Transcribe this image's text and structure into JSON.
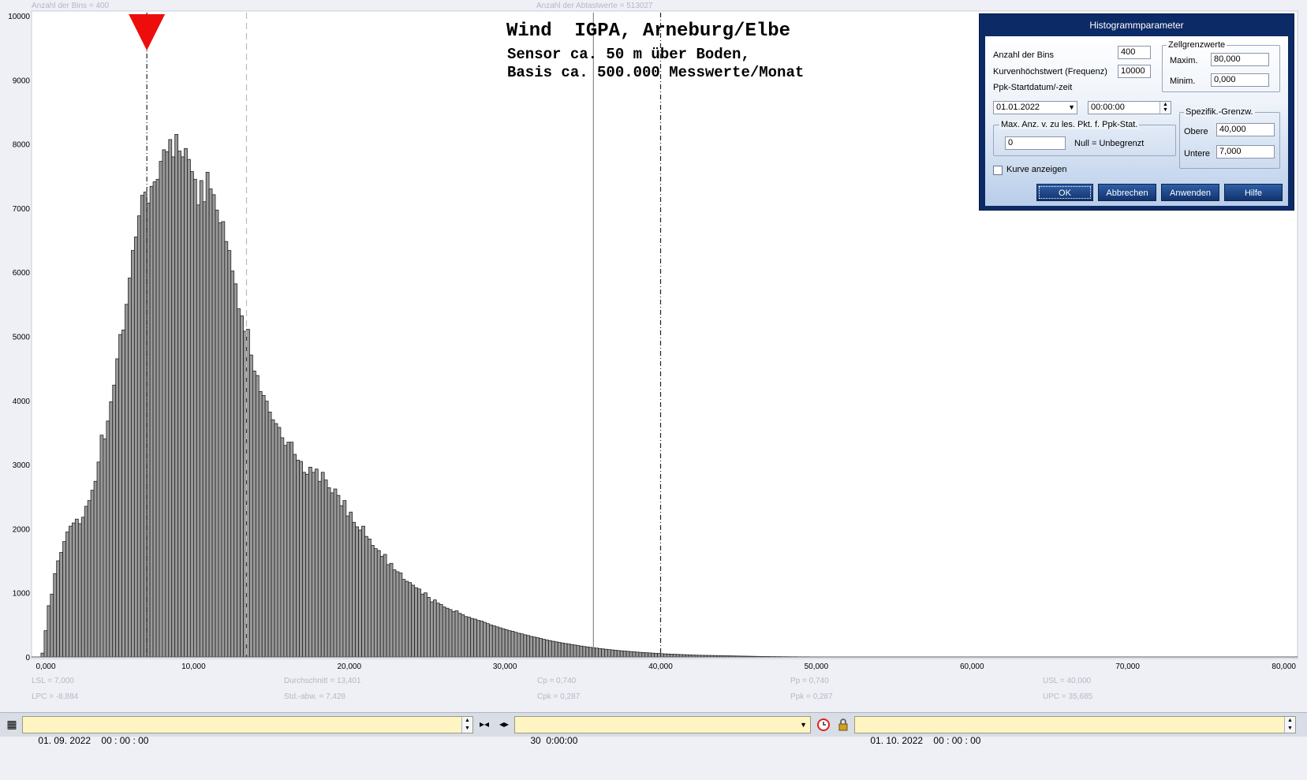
{
  "top_info": {
    "bins_text": "Anzahl der Bins =   400",
    "samples_text": "Anzahl der Abtastwerte = 513027"
  },
  "chart_title": {
    "line1": "Wind  IGPA, Arneburg/Elbe",
    "line2": "Sensor ca. 50 m über Boden,",
    "line3": "Basis ca. 500.000 Messwerte/Monat"
  },
  "chart_data": {
    "type": "bar",
    "xlim": [
      0,
      80
    ],
    "ylim": [
      0,
      10000
    ],
    "x_tick_labels": [
      "0,000",
      "10,000",
      "20,000",
      "30,000",
      "40,000",
      "50,000",
      "60,000",
      "70,000",
      "80,000"
    ],
    "y_tick_labels": [
      "0",
      "1000",
      "2000",
      "3000",
      "4000",
      "5000",
      "6000",
      "7000",
      "8000",
      "9000",
      "10000"
    ],
    "bin_width": 0.2,
    "bin_start": 0.2,
    "values": [
      60,
      410,
      800,
      980,
      1300,
      1500,
      1630,
      1800,
      1950,
      2040,
      2090,
      2150,
      2080,
      2180,
      2350,
      2440,
      2600,
      2740,
      3040,
      3460,
      3400,
      3680,
      3980,
      4240,
      4650,
      5030,
      5100,
      5500,
      5910,
      6340,
      6550,
      6880,
      7200,
      7250,
      7080,
      7340,
      7410,
      7450,
      7730,
      7910,
      7880,
      8070,
      7800,
      8150,
      7890,
      7800,
      7930,
      7760,
      7570,
      7450,
      7050,
      7430,
      7100,
      7560,
      7300,
      7210,
      6970,
      6770,
      6790,
      6480,
      6340,
      6020,
      5820,
      5430,
      5320,
      5080,
      5110,
      4710,
      4460,
      4390,
      4140,
      4080,
      3990,
      3820,
      3700,
      3640,
      3580,
      3420,
      3300,
      3350,
      3350,
      3160,
      3070,
      3050,
      2880,
      2850,
      2960,
      2880,
      2930,
      2740,
      2880,
      2760,
      2640,
      2560,
      2620,
      2520,
      2360,
      2440,
      2200,
      2260,
      2100,
      2030,
      1980,
      2040,
      1880,
      1840,
      1740,
      1690,
      1660,
      1570,
      1600,
      1440,
      1460,
      1360,
      1330,
      1310,
      1210,
      1180,
      1160,
      1120,
      1080,
      1060,
      980,
      1000,
      930,
      860,
      890,
      840,
      820,
      780,
      760,
      740,
      710,
      720,
      680,
      660,
      630,
      620,
      600,
      590,
      570,
      560,
      540,
      520,
      500,
      485,
      470,
      455,
      440,
      425,
      410,
      400,
      385,
      370,
      360,
      345,
      335,
      320,
      310,
      300,
      288,
      276,
      265,
      255,
      245,
      236,
      227,
      218,
      210,
      202,
      194,
      186,
      178,
      170,
      163,
      156,
      150,
      144,
      138,
      132,
      126,
      120,
      115,
      110,
      105,
      100,
      96,
      92,
      88,
      84,
      80,
      76,
      72,
      69,
      66,
      63,
      60,
      57,
      54,
      51,
      48,
      46,
      44,
      42,
      40,
      38,
      36,
      34,
      32,
      30,
      28,
      27,
      26,
      25,
      24,
      23,
      22,
      21,
      20,
      19,
      18,
      17,
      16,
      15,
      14,
      13,
      12,
      11,
      10,
      9,
      8,
      8,
      7,
      7,
      6,
      6,
      5,
      5,
      4,
      4,
      3,
      3,
      3,
      2,
      2,
      2,
      2,
      1,
      1,
      1,
      1,
      1,
      1,
      1,
      1,
      1,
      1,
      1,
      1,
      1,
      1,
      1,
      1,
      1,
      1,
      1,
      1,
      1,
      1,
      1,
      1,
      1,
      1,
      1,
      1,
      1,
      1,
      1,
      1,
      1,
      1,
      1,
      1,
      1,
      1,
      1,
      1,
      1,
      1,
      1,
      1,
      1,
      1,
      1,
      1,
      1,
      1,
      1,
      1,
      1,
      1,
      1,
      1,
      1,
      1,
      1,
      1,
      1,
      1,
      1,
      1,
      1,
      1,
      1,
      1,
      1,
      1,
      1,
      1,
      1,
      1,
      1,
      1,
      1,
      1,
      1,
      1,
      1,
      1,
      1,
      1,
      1,
      1,
      1,
      1,
      1,
      1,
      1,
      1,
      1,
      1,
      1,
      1,
      1,
      1,
      1,
      1,
      1,
      1,
      1,
      1,
      1,
      1,
      1,
      1,
      1,
      1,
      1,
      1,
      1,
      1,
      1,
      1,
      1,
      1,
      1,
      1,
      1,
      1,
      1,
      1,
      1,
      1,
      1,
      1,
      1,
      1,
      1,
      1,
      1,
      1,
      1,
      1,
      1,
      1,
      1,
      1,
      1,
      1,
      1,
      1,
      1,
      1,
      1,
      1,
      1,
      1,
      1,
      1,
      1,
      1
    ],
    "reference_lines": {
      "lsl": 7.0,
      "mean": 13.401,
      "upc": 35.685,
      "usl": 40.0
    },
    "marker_x": 7.0
  },
  "stats": {
    "lsl": "LSL = 7,000",
    "lpc": "LPC = -8,884",
    "mean": "Durchschnitt  = 13,401",
    "std": "Std.-abw.  = 7,428",
    "cp": "Cp  = 0,740",
    "cpk": "Cpk = 0,287",
    "pp": "Pp  = 0,740",
    "ppk": "Ppk = 0,287",
    "usl": "USL = 40,000",
    "upc": "UPC = 35,685"
  },
  "dialog": {
    "title": "Histogrammparameter",
    "bins_label": "Anzahl der Bins",
    "bins_value": "400",
    "freq_label": "Kurvenhöchstwert (Frequenz)",
    "freq_value": "10000",
    "start_label": "Ppk-Startdatum/-zeit",
    "start_date": "01.01.2022",
    "start_time": "00:00:00",
    "cell_group": "Zellgrenzwerte",
    "max_label": "Maxim.",
    "max_value": "80,000",
    "min_label": "Minim.",
    "min_value": "0,000",
    "spec_group": "Spezifik.-Grenzw.",
    "upper_label": "Obere",
    "upper_value": "40,000",
    "lower_label": "Untere",
    "lower_value": "7,000",
    "maxpts_group": "Max. Anz. v. zu les. Pkt. f. Ppk-Stat.",
    "maxpts_value": "0",
    "maxpts_hint": "Null = Unbegrenzt",
    "curve_label": "Kurve anzeigen",
    "ok": "OK",
    "cancel": "Abbrechen",
    "apply": "Anwenden",
    "help": "Hilfe"
  },
  "bottom": {
    "start": "01. 09. 2022    00 : 00 : 00",
    "duration": "30  0:00:00",
    "end": "01. 10. 2022    00 : 00 : 00"
  }
}
